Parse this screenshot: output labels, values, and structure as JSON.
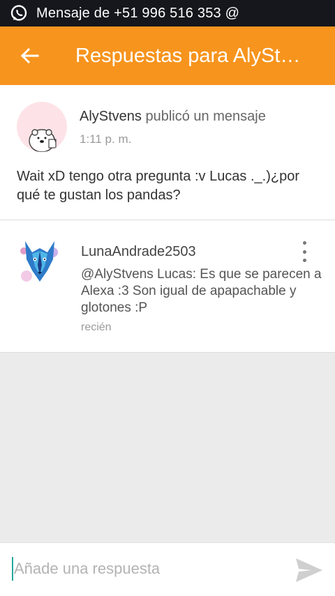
{
  "status_bar": {
    "icon": "whatsapp-icon",
    "notification_text": "Mensaje de +51 996 516 353 @"
  },
  "app_bar": {
    "back_icon": "arrow-back-icon",
    "title": "Respuestas para AlySt…"
  },
  "post": {
    "author": "AlyStvens",
    "action": " publicó un mensaje",
    "time": "1:11 p. m.",
    "body": "Wait xD tengo otra pregunta :v Lucas ._.)¿por qué te gustan los pandas?"
  },
  "reply": {
    "author": "LunaAndrade2503",
    "body": "@AlyStvens  Lucas: Es que se parecen a Alexa :3 Son igual de apapachable y glotones :P",
    "time": "recién",
    "menu_icon": "more-vert-icon"
  },
  "composer": {
    "placeholder": "Añade una respuesta",
    "value": "",
    "send_icon": "send-icon"
  },
  "colors": {
    "accent": "#f7941d",
    "status_bar": "#15171c",
    "background": "#ebebeb",
    "cursor": "#21a89a"
  }
}
